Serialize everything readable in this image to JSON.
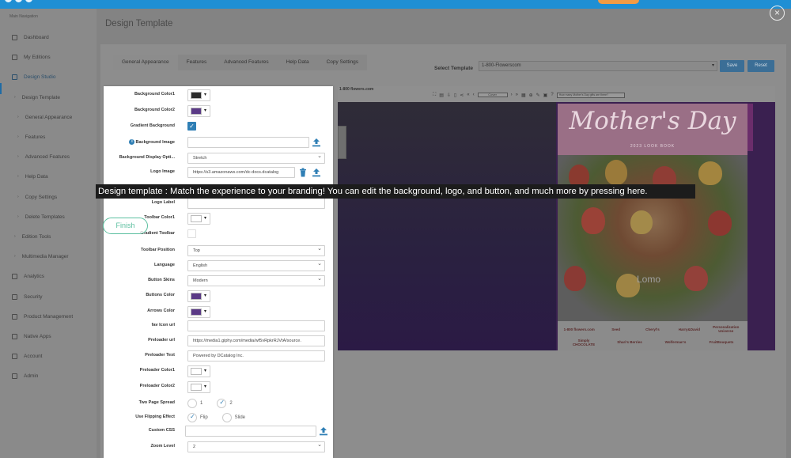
{
  "sidebar": {
    "heading": "Main Navigation",
    "items": [
      {
        "label": "Dashboard",
        "kind": "top",
        "icon": "gauge-icon"
      },
      {
        "label": "My Editions",
        "kind": "top",
        "icon": "pencil-icon"
      },
      {
        "label": "Design Studio",
        "kind": "top",
        "icon": "palette-icon",
        "active": true
      },
      {
        "label": "Design Template",
        "kind": "sub"
      },
      {
        "label": "General Appearance",
        "kind": "subsub"
      },
      {
        "label": "Features",
        "kind": "subsub"
      },
      {
        "label": "Advanced Features",
        "kind": "subsub"
      },
      {
        "label": "Help Data",
        "kind": "subsub"
      },
      {
        "label": "Copy Settings",
        "kind": "subsub"
      },
      {
        "label": "Delete Templates",
        "kind": "subsub"
      },
      {
        "label": "Edition Tools",
        "kind": "sub"
      },
      {
        "label": "Multimedia Manager",
        "kind": "sub"
      },
      {
        "label": "Analytics",
        "kind": "top",
        "icon": "bar-chart-icon"
      },
      {
        "label": "Security",
        "kind": "top",
        "icon": "shield-icon"
      },
      {
        "label": "Product Management",
        "kind": "top",
        "icon": "cart-icon"
      },
      {
        "label": "Native Apps",
        "kind": "top",
        "icon": "mobile-icon"
      },
      {
        "label": "Account",
        "kind": "top",
        "icon": "user-icon"
      },
      {
        "label": "Admin",
        "kind": "top",
        "icon": "gear-icon"
      }
    ]
  },
  "main": {
    "title": "Design Template",
    "tabs": [
      {
        "label": "General Appearance",
        "active": true
      },
      {
        "label": "Features"
      },
      {
        "label": "Advanced Features"
      },
      {
        "label": "Help Data"
      },
      {
        "label": "Copy Settings"
      }
    ],
    "select_template_label": "Select Template",
    "select_template_value": "1-800-Flowerscom",
    "save_label": "Save",
    "reset_label": "Reset"
  },
  "form": {
    "background_color1": {
      "label": "Background Color1",
      "color": "#2b2b2b"
    },
    "background_color2": {
      "label": "Background Color2",
      "color": "#5b3a86"
    },
    "gradient_background": {
      "label": "Gradient Background",
      "checked": true
    },
    "background_image": {
      "label": "Background Image",
      "value": ""
    },
    "background_display": {
      "label": "Background Display Opti...",
      "value": "Stretch"
    },
    "logo_image": {
      "label": "Logo Image",
      "value": "https://s3.amazonaws.com/dc-docs.dcatalog"
    },
    "logo_label": {
      "label": "Logo Label",
      "value": ""
    },
    "toolbar_color1": {
      "label": "Toolbar Color1",
      "color": "#ffffff"
    },
    "gradient_toolbar": {
      "label": "Gradient Toolbar",
      "checked": false
    },
    "toolbar_position": {
      "label": "Toolbar Position",
      "value": "Top"
    },
    "language": {
      "label": "Language",
      "value": "English"
    },
    "button_skins": {
      "label": "Button Skins",
      "value": "Modern"
    },
    "buttons_color": {
      "label": "Buttons Color",
      "color": "#5b3a86"
    },
    "arrows_color": {
      "label": "Arrows Color",
      "color": "#5b3a86"
    },
    "fav_icon": {
      "label": "fav Icon url",
      "value": ""
    },
    "preloader_url": {
      "label": "Preloader url",
      "value": "https://media1.giphy.com/media/wf5vRpkrRJVtA/source."
    },
    "preloader_text": {
      "label": "Preloader Text",
      "value": "Powered by DCatalog Inc."
    },
    "preloader_color1": {
      "label": "Preloader Color1",
      "color": "#ffffff"
    },
    "preloader_color2": {
      "label": "Preloader Color2",
      "color": "#ffffff"
    },
    "two_page_spread": {
      "label": "Two Page Spread",
      "options": [
        "1",
        "2"
      ],
      "selected": "2"
    },
    "flipping_effect": {
      "label": "Use Flipping Effect",
      "options": [
        "Flip",
        "Slide"
      ],
      "selected": "Flip"
    },
    "custom_css": {
      "label": "Custom CSS",
      "value": ""
    },
    "zoom_level": {
      "label": "Zoom Level",
      "value": "2"
    }
  },
  "preview": {
    "brand": "1-800 flowers.com",
    "page_indicator": "Cover",
    "search_placeholder": "How many Mother's Day gifts are there?",
    "cover_title": "Mother's Day",
    "cover_subtitle": "2023 LOOK BOOK",
    "watermark": "Lomo",
    "partner_logos": [
      "1-800 flowers.com",
      "Seed",
      "Cheryl's",
      "Harry&David",
      "Personalization Universe",
      "Simply CHOCOLATE",
      "Shari's Berries",
      "Wolferman's",
      "FruitBouquets"
    ]
  },
  "tour": {
    "tooltip": "Design template : Match the experience to your branding! You can edit the background, logo, and button, and much more by pressing here.",
    "finish_label": "Finish",
    "close_label": "×"
  }
}
